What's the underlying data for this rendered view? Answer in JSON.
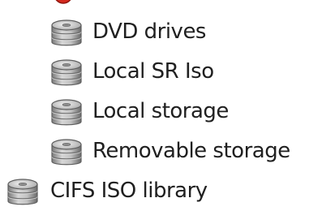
{
  "tree": {
    "items": [
      {
        "label": "DVD drives",
        "icon": "storage-disk-icon"
      },
      {
        "label": "Local SR Iso",
        "icon": "storage-disk-icon"
      },
      {
        "label": "Local storage",
        "icon": "storage-disk-icon"
      },
      {
        "label": "Removable storage",
        "icon": "storage-disk-icon"
      },
      {
        "label": "CIFS ISO library",
        "icon": "storage-disk-icon"
      }
    ],
    "partial_top_icon": "error-badge-icon"
  },
  "colors": {
    "disk_light": "#e3e3e3",
    "disk_mid": "#a9a9a9",
    "disk_dark": "#6f6f6f",
    "error_red": "#d42a1e",
    "text": "#202020"
  }
}
